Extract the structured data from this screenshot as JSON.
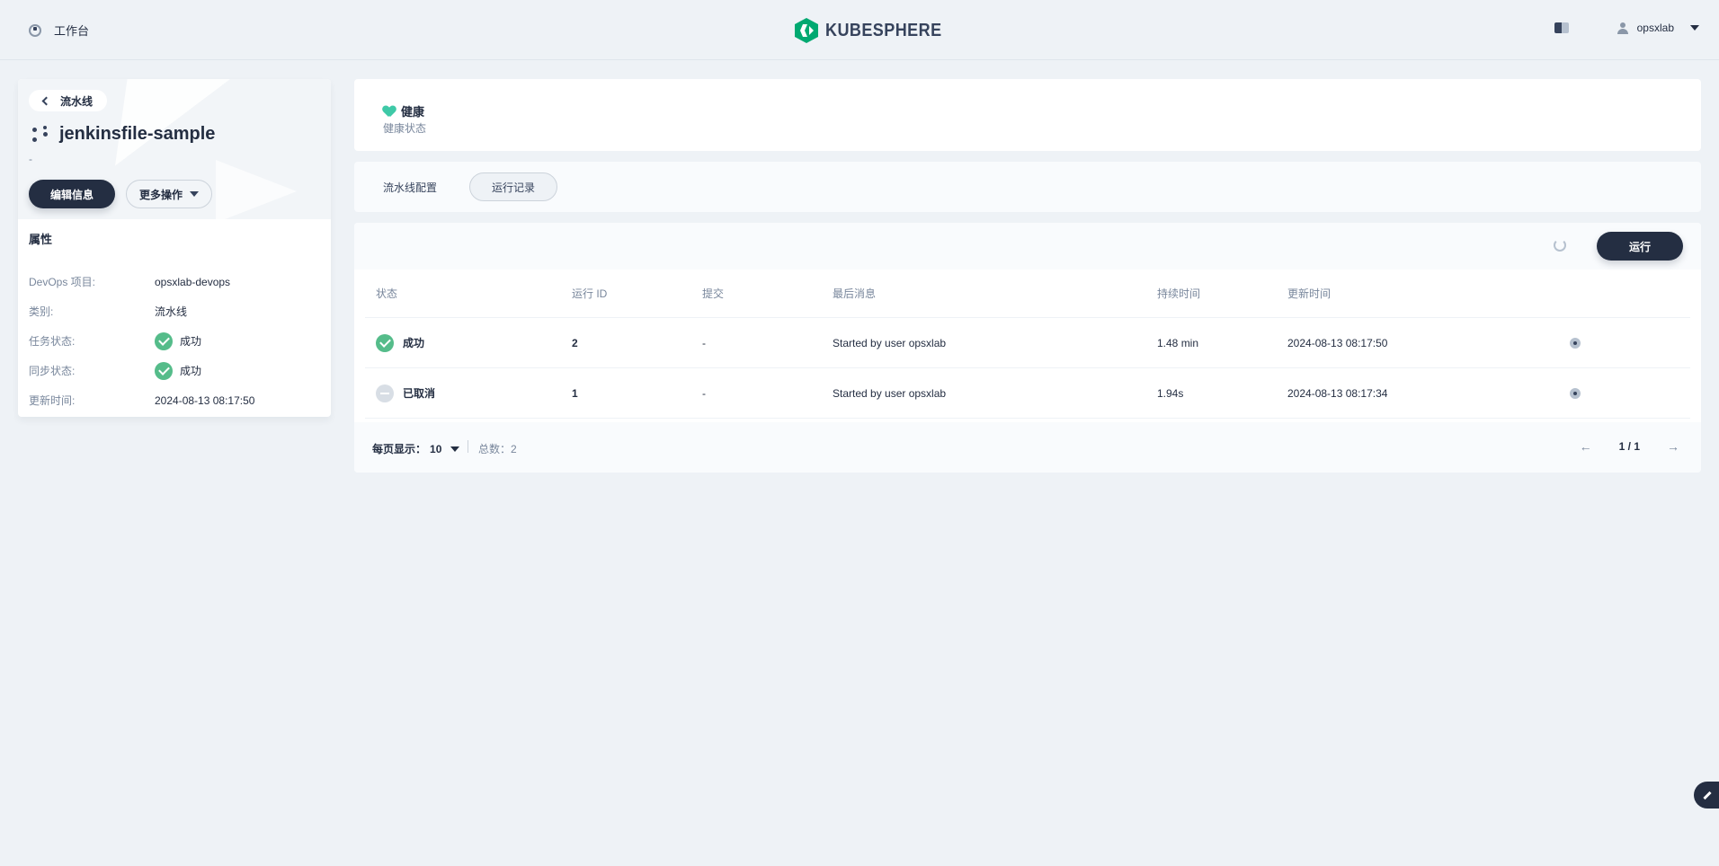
{
  "topnav": {
    "workbench_label": "工作台",
    "logo_text": "KUBESPHERE",
    "username": "opsxlab"
  },
  "left": {
    "back_label": "流水线",
    "title": "jenkinsfile-sample",
    "description": "-",
    "edit_button": "编辑信息",
    "more_button": "更多操作",
    "attributes_title": "属性",
    "attributes": [
      {
        "key": "DevOps 项目:",
        "value": "opsxlab-devops"
      },
      {
        "key": "类别:",
        "value": "流水线"
      },
      {
        "key": "任务状态:",
        "value": "成功"
      },
      {
        "key": "同步状态:",
        "value": "成功"
      },
      {
        "key": "更新时间:",
        "value": "2024-08-13 08:17:50"
      }
    ]
  },
  "health": {
    "status": "健康",
    "label": "健康状态"
  },
  "tabs": [
    "流水线配置",
    "运行记录"
  ],
  "table": {
    "run_button": "运行",
    "headers": [
      "状态",
      "运行 ID",
      "提交",
      "最后消息",
      "持续时间",
      "更新时间"
    ],
    "rows": [
      {
        "status": "成功",
        "id": "2",
        "commit": "-",
        "message": "Started by user opsxlab",
        "duration": "1.48 min",
        "updated": "2024-08-13 08:17:50"
      },
      {
        "status": "已取消",
        "id": "1",
        "commit": "-",
        "message": "Started by user opsxlab",
        "duration": "1.94s",
        "updated": "2024-08-13 08:17:34"
      }
    ]
  },
  "pagination": {
    "per_page_label": "每页显示：",
    "per_page_value": "10",
    "total": "总数：2",
    "page": "1 / 1"
  },
  "colors": {
    "primary_dark": "#242e42",
    "success": "#55bc8a",
    "brand": "#00a971",
    "background": "#eef2f6"
  }
}
